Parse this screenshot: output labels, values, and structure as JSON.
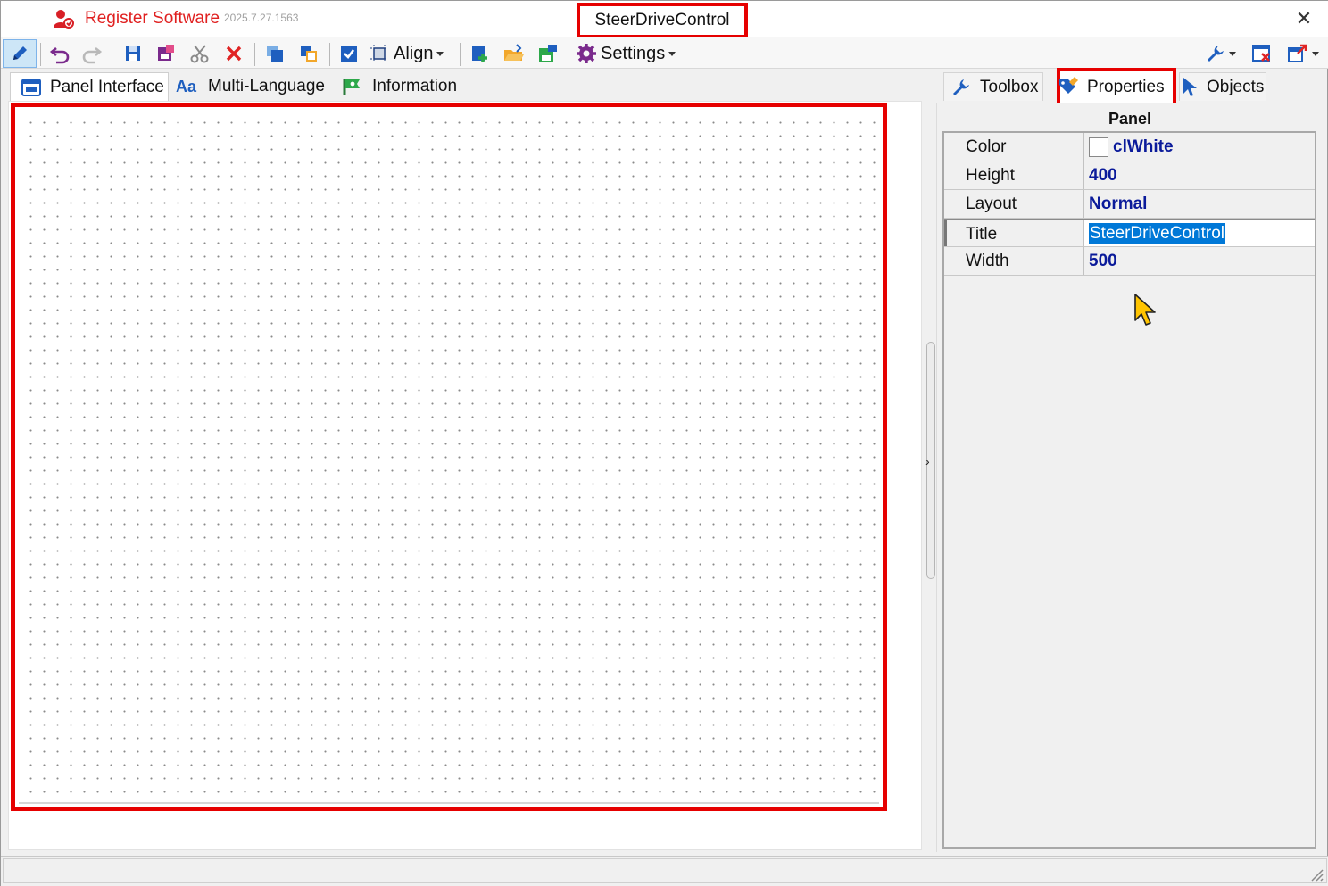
{
  "app": {
    "register_label": "Register Software",
    "version": "2025.7.27.1563",
    "window_title": "SteerDriveControl",
    "close_glyph": "✕"
  },
  "toolbar": {
    "align_label": "Align",
    "settings_label": "Settings",
    "icons": [
      "edit-icon",
      "undo-icon",
      "redo-icon",
      "save-icon",
      "save-as-icon",
      "cut-icon",
      "delete-icon",
      "bring-front-icon",
      "send-back-icon",
      "checkbox-icon",
      "select-bounds-icon",
      "align-icon",
      "add-form-icon",
      "open-folder-icon",
      "export-icon",
      "settings-gear-icon",
      "tools-wrench-icon",
      "close-panel-icon",
      "export-window-icon"
    ]
  },
  "left_tabs": [
    {
      "label": "Panel Interface",
      "icon": "panel-icon"
    },
    {
      "label": "Multi-Language",
      "icon": "font-aa-icon"
    },
    {
      "label": "Information",
      "icon": "info-flag-icon"
    }
  ],
  "right_tabs": [
    {
      "label": "Toolbox",
      "icon": "wrench-icon"
    },
    {
      "label": "Properties",
      "icon": "pen-tag-icon"
    },
    {
      "label": "Objects",
      "icon": "pointer-icon"
    }
  ],
  "properties": {
    "header": "Panel",
    "rows": [
      {
        "name": "Color",
        "value": "clWhite"
      },
      {
        "name": "Height",
        "value": "400"
      },
      {
        "name": "Layout",
        "value": "Normal"
      },
      {
        "name": "Title",
        "value": "SteerDriveControl"
      },
      {
        "name": "Width",
        "value": "500"
      }
    ]
  },
  "colors": {
    "highlight_red": "#e60000",
    "brand_red": "#e02020",
    "value_blue": "#0a1a9a",
    "selection_blue": "#0078d7",
    "cursor_yellow": "#ffc400"
  },
  "splitter_glyph": "›",
  "caret_glyph": "▾"
}
